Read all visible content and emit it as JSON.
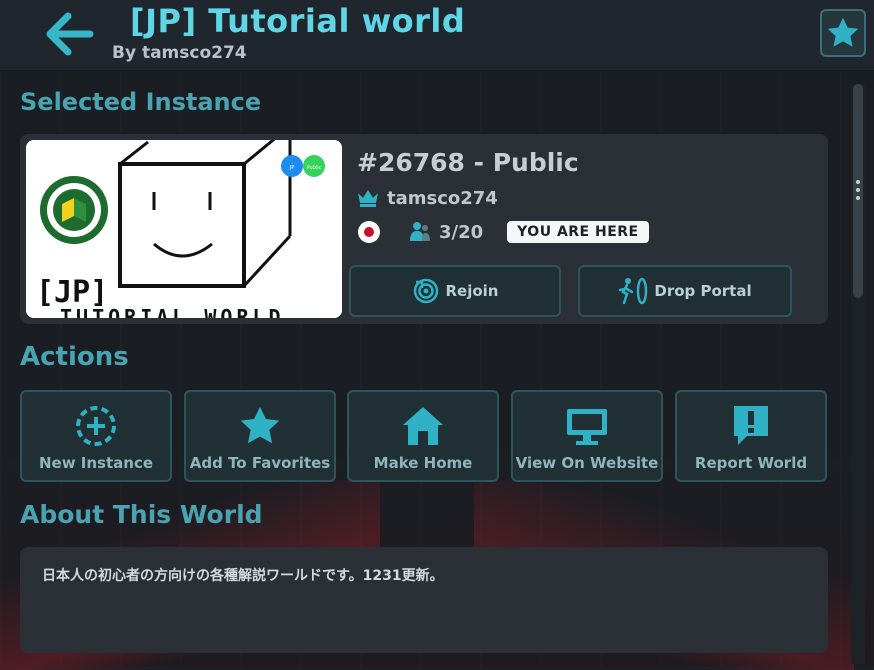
{
  "header": {
    "title": "[JP]  Tutorial world",
    "author": "By tamsco274"
  },
  "instance": {
    "heading": "Selected Instance",
    "id_label": "#26768 - Public",
    "owner": "tamsco274",
    "player_count": "3/20",
    "here_badge": "YOU ARE HERE",
    "rejoin_label": "Rejoin",
    "drop_portal_label": "Drop Portal",
    "thumbnail": {
      "logo_text": "[JP]",
      "logo_sub": "TUTORIAL WORLD",
      "badge_left": "JP",
      "badge_right": "Public"
    }
  },
  "actions": {
    "heading": "Actions",
    "items": [
      {
        "label": "New Instance",
        "icon": "plus-circle-dashed-icon"
      },
      {
        "label": "Add To Favorites",
        "icon": "star-icon"
      },
      {
        "label": "Make Home",
        "icon": "home-icon"
      },
      {
        "label": "View On Website",
        "icon": "monitor-icon"
      },
      {
        "label": "Report World",
        "icon": "report-icon"
      }
    ]
  },
  "about": {
    "heading": "About This World",
    "text": "日本人の初心者の方向けの各種解説ワールドです。1231更新。"
  },
  "colors": {
    "accent": "#5fd6e6",
    "icon": "#2fb2c6",
    "card": "#2b3036",
    "button": "#203034"
  }
}
